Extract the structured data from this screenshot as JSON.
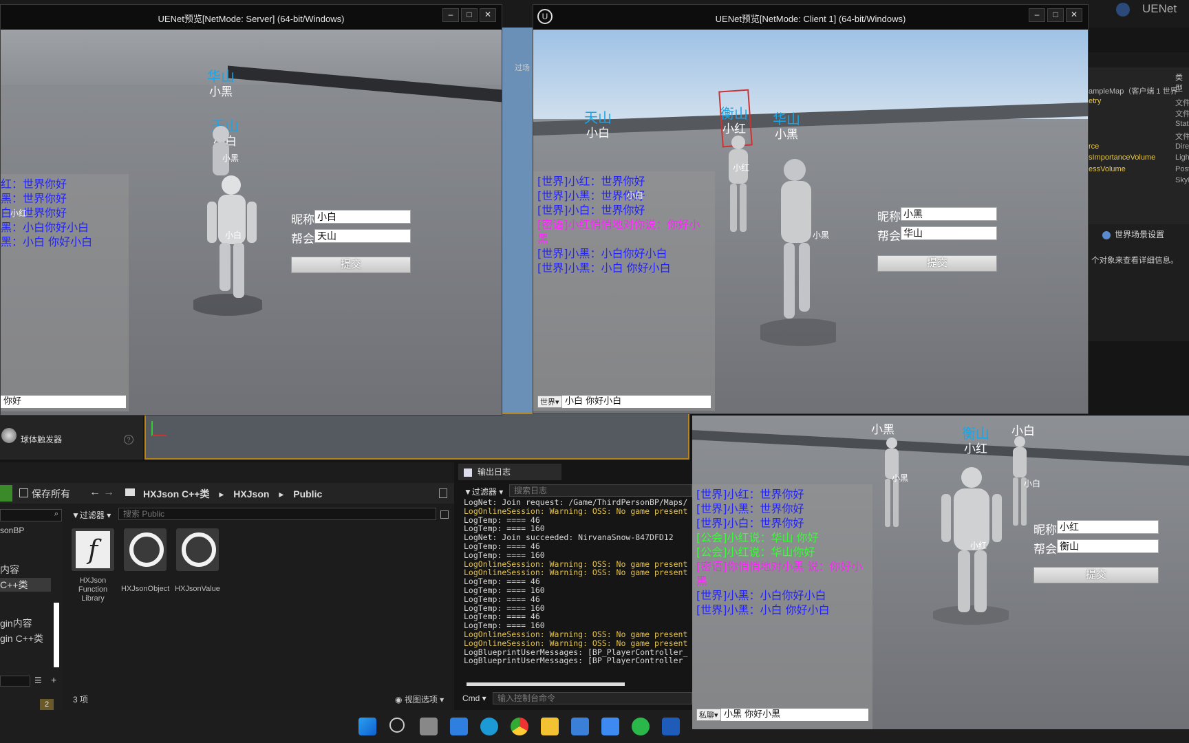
{
  "server_window": {
    "title": "UENet预览[NetMode: Server]  (64-bit/Windows)",
    "chat": [
      {
        "type": "world",
        "text": "红：世界你好"
      },
      {
        "type": "world",
        "text": "黑：世界你好"
      },
      {
        "type": "world",
        "text": "白：世界你好"
      },
      {
        "type": "world",
        "text": "黑：小白你好小白"
      },
      {
        "type": "world",
        "text": "黑：小白 你好小白"
      }
    ],
    "chat_input_value": "你好",
    "players": [
      {
        "guild": "华山",
        "name": "小黑"
      },
      {
        "guild": "天山",
        "name": "小白"
      }
    ],
    "body_labels": [
      "小黑",
      "小白",
      "小红"
    ],
    "form": {
      "nick_label": "昵称",
      "nick_value": "小白",
      "guild_label": "帮会",
      "guild_value": "天山",
      "submit": "提交"
    }
  },
  "client1_window": {
    "title": "UENet预览[NetMode: Client 1]  (64-bit/Windows)",
    "chat": [
      {
        "type": "world",
        "text": "[世界]小红：世界你好"
      },
      {
        "type": "world",
        "text": "[世界]小黑：世界你好"
      },
      {
        "type": "world",
        "text": "[世界]小白：世界你好"
      },
      {
        "type": "whisper",
        "text": "[密语]小红悄悄地对你说：你好小黑"
      },
      {
        "type": "world",
        "text": "[世界]小黑：小白你好小白"
      },
      {
        "type": "world",
        "text": "[世界]小黑：小白 你好小白"
      }
    ],
    "channel": "世界",
    "chat_input_value": "小白 你好小白",
    "players": [
      {
        "guild": "天山",
        "name": "小白"
      },
      {
        "guild": "衡山",
        "name": "小红"
      },
      {
        "guild": "华山",
        "name": "小黑"
      }
    ],
    "body_labels": [
      "小红",
      "小黑",
      "小白"
    ],
    "form": {
      "nick_label": "昵称",
      "nick_value": "小黑",
      "guild_label": "帮会",
      "guild_value": "华山",
      "submit": "提交"
    }
  },
  "client2_window": {
    "chat": [
      {
        "type": "world",
        "text": "[世界]小红：世界你好"
      },
      {
        "type": "world",
        "text": "[世界]小黑：世界你好"
      },
      {
        "type": "world",
        "text": "[世界]小白：世界你好"
      },
      {
        "type": "guild",
        "text": "[公会]小红说：华山 你好"
      },
      {
        "type": "guild",
        "text": "[公会]小红说：华山你好"
      },
      {
        "type": "whisper",
        "text": "[密语]你悄悄地对小黑 说：你好小黑"
      },
      {
        "type": "world",
        "text": "[世界]小黑：小白你好小白"
      },
      {
        "type": "world",
        "text": "[世界]小黑：小白 你好小白"
      }
    ],
    "channel": "私聊",
    "chat_input_value": "小黑 你好小黑",
    "top_names": [
      "小黑",
      "小白"
    ],
    "player": {
      "guild": "衡山",
      "name": "小红"
    },
    "body_labels": [
      "小黑",
      "小白",
      "小红"
    ],
    "form": {
      "nick_label": "昵称",
      "nick_value": "小红",
      "guild_label": "帮会",
      "guild_value": "衡山",
      "submit": "提交"
    }
  },
  "editor": {
    "top_right_label": "UENet",
    "toolbar_partial": "过场",
    "details_column_header": "类型",
    "outliner_rows": [
      {
        "name": "ampleMap（客户端 1 世界",
        "type": ""
      },
      {
        "name": "etry",
        "type": "文件"
      },
      {
        "name": "",
        "type": "文件"
      },
      {
        "name": "",
        "type": "Stati"
      },
      {
        "name": "",
        "type": "文件"
      },
      {
        "name": "rce",
        "type": "Direc"
      },
      {
        "name": "sImportanceVolume",
        "type": "Light"
      },
      {
        "name": "essVolume",
        "type": "Post"
      },
      {
        "name": "",
        "type": "SkyL"
      }
    ],
    "world_settings_tab": "世界场景设置",
    "details_hint": "个对象来查看详细信息。",
    "place_actor_item": "球体触发器",
    "content_browser": {
      "save_all": "保存所有",
      "path": [
        "HXJson C++类",
        "HXJson",
        "Public"
      ],
      "filter_label": "过滤器",
      "search_placeholder": "搜索 Public",
      "tree_items": [
        "sonBP",
        "内容",
        "C++类",
        "gin内容",
        "gin C++类"
      ],
      "badge_count": "2",
      "assets": [
        "HXJson Function Library",
        "HXJsonObject",
        "HXJsonValue"
      ],
      "item_count": "3 项",
      "view_options": "视图选项"
    },
    "output_log": {
      "tab_label": "输出日志",
      "filter_label": "过滤器",
      "search_placeholder": "搜索日志",
      "lines": [
        {
          "level": "info",
          "text": "LogNet: Join request: /Game/ThirdPersonBP/Maps/"
        },
        {
          "level": "warn",
          "text": "LogOnlineSession: Warning: OSS: No game present"
        },
        {
          "level": "info",
          "text": "LogTemp: ==== 46"
        },
        {
          "level": "info",
          "text": "LogTemp: ==== 160"
        },
        {
          "level": "info",
          "text": "LogNet: Join succeeded: NirvanaSnow-847DFD12"
        },
        {
          "level": "info",
          "text": "LogTemp: ==== 46"
        },
        {
          "level": "info",
          "text": "LogTemp: ==== 160"
        },
        {
          "level": "warn",
          "text": "LogOnlineSession: Warning: OSS: No game present"
        },
        {
          "level": "warn",
          "text": "LogOnlineSession: Warning: OSS: No game present"
        },
        {
          "level": "info",
          "text": "LogTemp: ==== 46"
        },
        {
          "level": "info",
          "text": "LogTemp: ==== 160"
        },
        {
          "level": "info",
          "text": "LogTemp: ==== 46"
        },
        {
          "level": "info",
          "text": "LogTemp: ==== 160"
        },
        {
          "level": "info",
          "text": "LogTemp: ==== 46"
        },
        {
          "level": "info",
          "text": "LogTemp: ==== 160"
        },
        {
          "level": "warn",
          "text": "LogOnlineSession: Warning: OSS: No game present"
        },
        {
          "level": "warn",
          "text": "LogOnlineSession: Warning: OSS: No game present"
        },
        {
          "level": "info",
          "text": "LogBlueprintUserMessages: [BP_PlayerController_"
        },
        {
          "level": "info",
          "text": "LogBlueprintUserMessages: [BP_PlayerController_"
        }
      ],
      "cmd_label": "Cmd",
      "console_placeholder": "输入控制台命令"
    }
  },
  "colors": {
    "world": "#2222ff",
    "whisper": "#ff22ff",
    "guild": "#33ff33",
    "guild_name": "#19a6e8"
  }
}
